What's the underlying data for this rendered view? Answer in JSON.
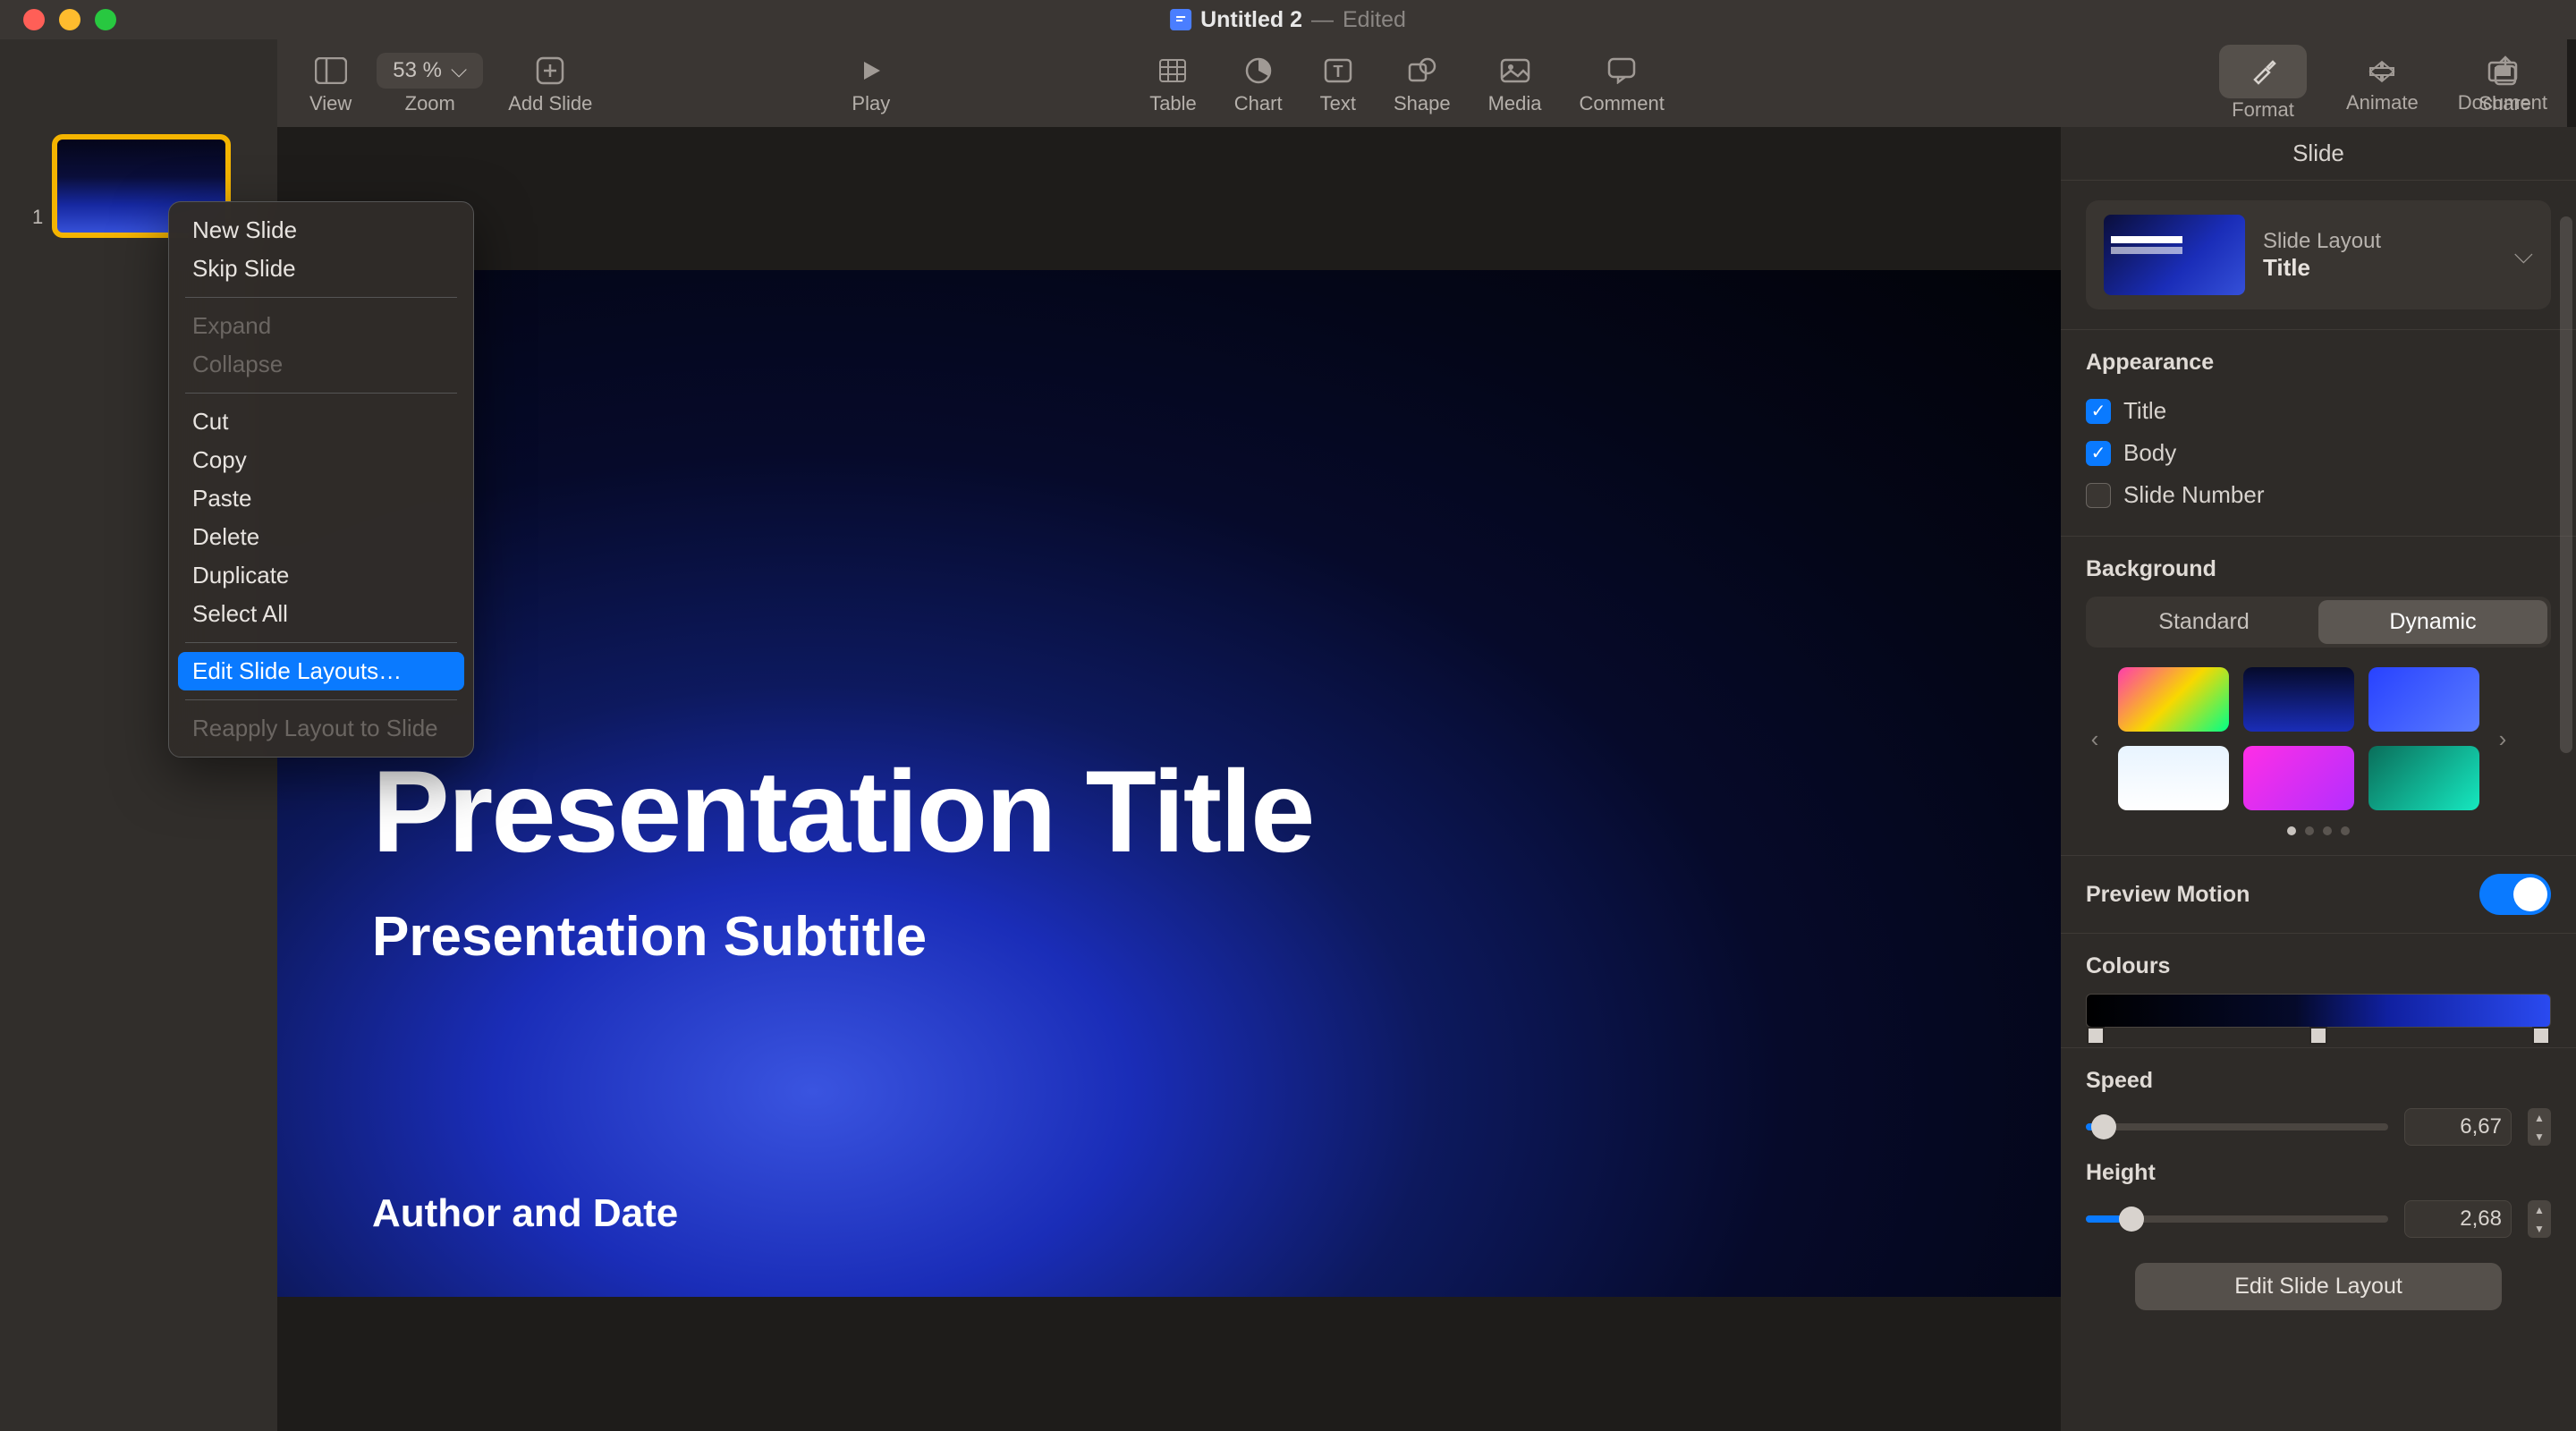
{
  "titlebar": {
    "doc_name": "Untitled 2",
    "sep": "—",
    "status": "Edited"
  },
  "toolbar": {
    "view": "View",
    "zoom_label": "Zoom",
    "zoom_value": "53 %",
    "add_slide": "Add Slide",
    "play": "Play",
    "table": "Table",
    "chart": "Chart",
    "text": "Text",
    "shape": "Shape",
    "media": "Media",
    "comment": "Comment",
    "share": "Share",
    "format": "Format",
    "animate": "Animate",
    "document": "Document"
  },
  "thumb": {
    "number": "1"
  },
  "slide": {
    "title": "Presentation Title",
    "subtitle": "Presentation Subtitle",
    "author": "Author and Date"
  },
  "context_menu": {
    "new_slide": "New Slide",
    "skip_slide": "Skip Slide",
    "expand": "Expand",
    "collapse": "Collapse",
    "cut": "Cut",
    "copy": "Copy",
    "paste": "Paste",
    "delete": "Delete",
    "duplicate": "Duplicate",
    "select_all": "Select All",
    "edit_layouts": "Edit Slide Layouts…",
    "reapply": "Reapply Layout to Slide"
  },
  "inspector": {
    "tab": "Slide",
    "layout_label": "Slide Layout",
    "layout_name": "Title",
    "appearance": "Appearance",
    "chk_title": "Title",
    "chk_body": "Body",
    "chk_num": "Slide Number",
    "background": "Background",
    "seg_standard": "Standard",
    "seg_dynamic": "Dynamic",
    "preview_motion": "Preview Motion",
    "colours": "Colours",
    "speed": "Speed",
    "speed_val": "6,67",
    "height": "Height",
    "height_val": "2,68",
    "edit_layout_btn": "Edit Slide Layout"
  },
  "bg_swatches": [
    "linear-gradient(135deg,#ff3cac,#f8d800,#00ff87)",
    "linear-gradient(180deg,#050a2a,#1a2db8)",
    "linear-gradient(135deg,#2842ff,#5a7cff)",
    "linear-gradient(180deg,#e8f4ff,#ffffff)",
    "linear-gradient(135deg,#ff2ee6,#b42eff)",
    "linear-gradient(135deg,#0a6e5a,#16e8c0)"
  ]
}
